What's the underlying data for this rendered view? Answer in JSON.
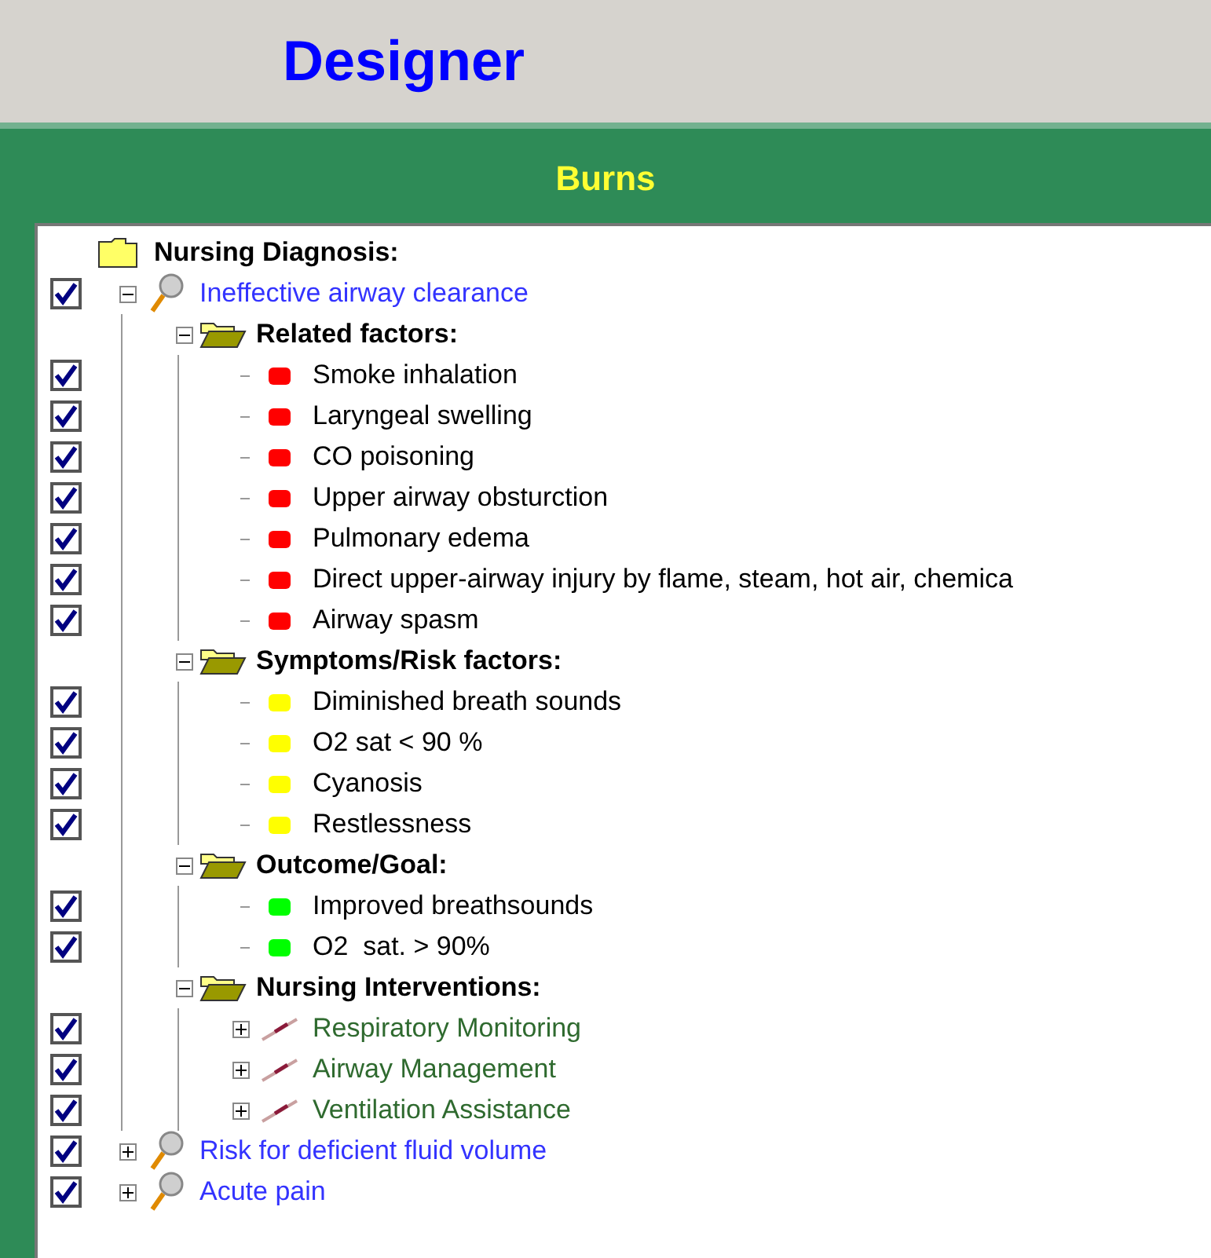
{
  "header": {
    "title": "Designer"
  },
  "panel": {
    "title": "Burns"
  },
  "tree": {
    "label": "Nursing Diagnosis:",
    "children": [
      {
        "kind": "diagnosis",
        "label": "Ineffective airway clearance",
        "checked": true,
        "expanded": true,
        "children": [
          {
            "kind": "group",
            "label": "Related factors:",
            "expanded": true,
            "children": [
              {
                "kind": "item",
                "label": "Smoke inhalation",
                "checked": true,
                "color": "#ff0000"
              },
              {
                "kind": "item",
                "label": "Laryngeal swelling",
                "checked": true,
                "color": "#ff0000"
              },
              {
                "kind": "item",
                "label": "CO poisoning",
                "checked": true,
                "color": "#ff0000"
              },
              {
                "kind": "item",
                "label": "Upper airway obsturction",
                "checked": true,
                "color": "#ff0000"
              },
              {
                "kind": "item",
                "label": "Pulmonary edema",
                "checked": true,
                "color": "#ff0000"
              },
              {
                "kind": "item",
                "label": "Direct upper-airway injury by flame, steam, hot air, chemica",
                "checked": true,
                "color": "#ff0000"
              },
              {
                "kind": "item",
                "label": "Airway spasm",
                "checked": true,
                "color": "#ff0000"
              }
            ]
          },
          {
            "kind": "group",
            "label": "Symptoms/Risk factors:",
            "expanded": true,
            "children": [
              {
                "kind": "item",
                "label": "Diminished breath sounds",
                "checked": true,
                "color": "#ffff00"
              },
              {
                "kind": "item",
                "label": "O2 sat < 90 %",
                "checked": true,
                "color": "#ffff00"
              },
              {
                "kind": "item",
                "label": "Cyanosis",
                "checked": true,
                "color": "#ffff00"
              },
              {
                "kind": "item",
                "label": "Restlessness",
                "checked": true,
                "color": "#ffff00"
              }
            ]
          },
          {
            "kind": "group",
            "label": "Outcome/Goal:",
            "expanded": true,
            "children": [
              {
                "kind": "item",
                "label": "Improved breathsounds",
                "checked": true,
                "color": "#00ff00"
              },
              {
                "kind": "item",
                "label": "O2  sat. > 90%",
                "checked": true,
                "color": "#00ff00"
              }
            ]
          },
          {
            "kind": "group",
            "label": "Nursing Interventions:",
            "expanded": true,
            "children": [
              {
                "kind": "intervention",
                "label": "Respiratory Monitoring",
                "checked": true,
                "expanded": false
              },
              {
                "kind": "intervention",
                "label": "Airway Management",
                "checked": true,
                "expanded": false
              },
              {
                "kind": "intervention",
                "label": "Ventilation Assistance",
                "checked": true,
                "expanded": false
              }
            ]
          }
        ]
      },
      {
        "kind": "diagnosis",
        "label": "Risk for deficient fluid volume",
        "checked": true,
        "expanded": false
      },
      {
        "kind": "diagnosis",
        "label": "Acute pain",
        "checked": true,
        "expanded": false
      }
    ]
  }
}
